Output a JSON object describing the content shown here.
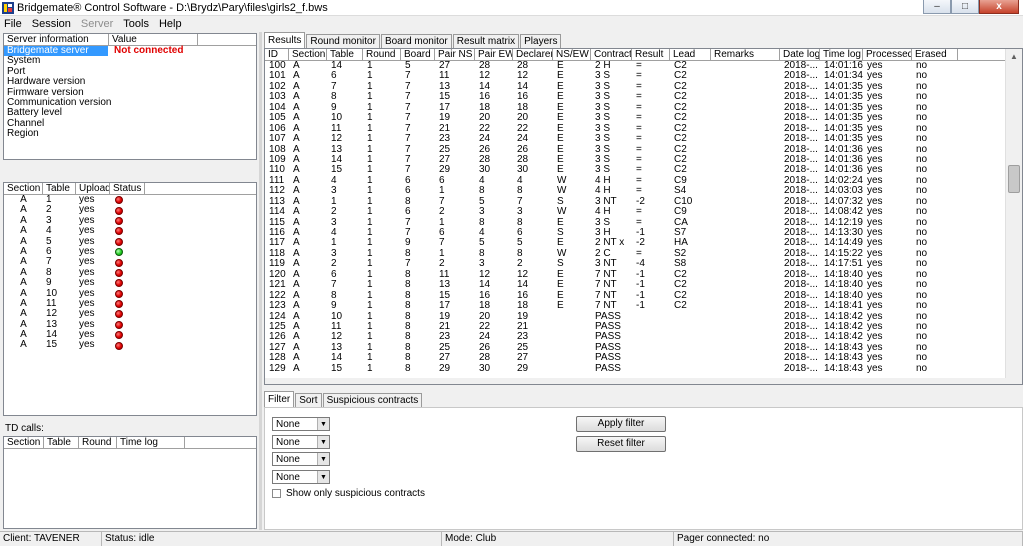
{
  "window": {
    "title": "Bridgemate® Control Software - D:\\Brydz\\Pary\\files\\girls2_f.bws",
    "minimize": "–",
    "maximize": "□",
    "close": "x"
  },
  "menu": [
    "File",
    "Session",
    "Server",
    "Tools",
    "Help"
  ],
  "server_info": {
    "headers": [
      "Server information",
      "Value"
    ],
    "rows": [
      {
        "k": "Bridgemate server",
        "v": "Not connected"
      },
      {
        "k": "System",
        "v": ""
      },
      {
        "k": "Port",
        "v": ""
      },
      {
        "k": "Hardware version",
        "v": ""
      },
      {
        "k": "Firmware version",
        "v": ""
      },
      {
        "k": "Communication version",
        "v": ""
      },
      {
        "k": "Battery level",
        "v": ""
      },
      {
        "k": "Channel",
        "v": ""
      },
      {
        "k": "Region",
        "v": ""
      }
    ]
  },
  "tables_panel": {
    "headers": [
      "Section",
      "Table",
      "Upload",
      "Status"
    ],
    "rows": [
      {
        "s": "A",
        "t": "1",
        "u": "yes",
        "st": "red"
      },
      {
        "s": "A",
        "t": "2",
        "u": "yes",
        "st": "red"
      },
      {
        "s": "A",
        "t": "3",
        "u": "yes",
        "st": "red"
      },
      {
        "s": "A",
        "t": "4",
        "u": "yes",
        "st": "red"
      },
      {
        "s": "A",
        "t": "5",
        "u": "yes",
        "st": "red"
      },
      {
        "s": "A",
        "t": "6",
        "u": "yes",
        "st": "green"
      },
      {
        "s": "A",
        "t": "7",
        "u": "yes",
        "st": "red"
      },
      {
        "s": "A",
        "t": "8",
        "u": "yes",
        "st": "red"
      },
      {
        "s": "A",
        "t": "9",
        "u": "yes",
        "st": "red"
      },
      {
        "s": "A",
        "t": "10",
        "u": "yes",
        "st": "red"
      },
      {
        "s": "A",
        "t": "11",
        "u": "yes",
        "st": "red"
      },
      {
        "s": "A",
        "t": "12",
        "u": "yes",
        "st": "red"
      },
      {
        "s": "A",
        "t": "13",
        "u": "yes",
        "st": "red"
      },
      {
        "s": "A",
        "t": "14",
        "u": "yes",
        "st": "red"
      },
      {
        "s": "A",
        "t": "15",
        "u": "yes",
        "st": "red"
      }
    ]
  },
  "td_calls": {
    "label": "TD calls:",
    "headers": [
      "Section",
      "Table",
      "Round",
      "Time log"
    ]
  },
  "tabs": [
    "Results",
    "Round monitor",
    "Board monitor",
    "Result matrix",
    "Players"
  ],
  "results": {
    "headers": [
      "ID",
      "Section",
      "Table",
      "Round",
      "Board",
      "Pair NS",
      "Pair EW",
      "Declarer",
      "NS/EW",
      "Contract",
      "Result",
      "Lead",
      "Remarks",
      "Date log",
      "Time log",
      "Processed",
      "Erased"
    ],
    "rows": [
      [
        "100",
        "A",
        "14",
        "1",
        "5",
        "27",
        "28",
        "28",
        "E",
        "2 H",
        "=",
        "C2",
        "",
        "2018-...",
        "14:01:16",
        "yes",
        "no"
      ],
      [
        "101",
        "A",
        "6",
        "1",
        "7",
        "11",
        "12",
        "12",
        "E",
        "3 S",
        "=",
        "C2",
        "",
        "2018-...",
        "14:01:34",
        "yes",
        "no"
      ],
      [
        "102",
        "A",
        "7",
        "1",
        "7",
        "13",
        "14",
        "14",
        "E",
        "3 S",
        "=",
        "C2",
        "",
        "2018-...",
        "14:01:35",
        "yes",
        "no"
      ],
      [
        "103",
        "A",
        "8",
        "1",
        "7",
        "15",
        "16",
        "16",
        "E",
        "3 S",
        "=",
        "C2",
        "",
        "2018-...",
        "14:01:35",
        "yes",
        "no"
      ],
      [
        "104",
        "A",
        "9",
        "1",
        "7",
        "17",
        "18",
        "18",
        "E",
        "3 S",
        "=",
        "C2",
        "",
        "2018-...",
        "14:01:35",
        "yes",
        "no"
      ],
      [
        "105",
        "A",
        "10",
        "1",
        "7",
        "19",
        "20",
        "20",
        "E",
        "3 S",
        "=",
        "C2",
        "",
        "2018-...",
        "14:01:35",
        "yes",
        "no"
      ],
      [
        "106",
        "A",
        "11",
        "1",
        "7",
        "21",
        "22",
        "22",
        "E",
        "3 S",
        "=",
        "C2",
        "",
        "2018-...",
        "14:01:35",
        "yes",
        "no"
      ],
      [
        "107",
        "A",
        "12",
        "1",
        "7",
        "23",
        "24",
        "24",
        "E",
        "3 S",
        "=",
        "C2",
        "",
        "2018-...",
        "14:01:35",
        "yes",
        "no"
      ],
      [
        "108",
        "A",
        "13",
        "1",
        "7",
        "25",
        "26",
        "26",
        "E",
        "3 S",
        "=",
        "C2",
        "",
        "2018-...",
        "14:01:36",
        "yes",
        "no"
      ],
      [
        "109",
        "A",
        "14",
        "1",
        "7",
        "27",
        "28",
        "28",
        "E",
        "3 S",
        "=",
        "C2",
        "",
        "2018-...",
        "14:01:36",
        "yes",
        "no"
      ],
      [
        "110",
        "A",
        "15",
        "1",
        "7",
        "29",
        "30",
        "30",
        "E",
        "3 S",
        "=",
        "C2",
        "",
        "2018-...",
        "14:01:36",
        "yes",
        "no"
      ],
      [
        "111",
        "A",
        "4",
        "1",
        "6",
        "6",
        "4",
        "4",
        "W",
        "4 H",
        "=",
        "C9",
        "",
        "2018-...",
        "14:02:24",
        "yes",
        "no"
      ],
      [
        "112",
        "A",
        "3",
        "1",
        "6",
        "1",
        "8",
        "8",
        "W",
        "4 H",
        "=",
        "S4",
        "",
        "2018-...",
        "14:03:03",
        "yes",
        "no"
      ],
      [
        "113",
        "A",
        "1",
        "1",
        "8",
        "7",
        "5",
        "7",
        "S",
        "3 NT",
        "-2",
        "C10",
        "",
        "2018-...",
        "14:07:32",
        "yes",
        "no"
      ],
      [
        "114",
        "A",
        "2",
        "1",
        "6",
        "2",
        "3",
        "3",
        "W",
        "4 H",
        "=",
        "C9",
        "",
        "2018-...",
        "14:08:42",
        "yes",
        "no"
      ],
      [
        "115",
        "A",
        "3",
        "1",
        "7",
        "1",
        "8",
        "8",
        "E",
        "3 S",
        "=",
        "CA",
        "",
        "2018-...",
        "14:12:19",
        "yes",
        "no"
      ],
      [
        "116",
        "A",
        "4",
        "1",
        "7",
        "6",
        "4",
        "6",
        "S",
        "3 H",
        "-1",
        "S7",
        "",
        "2018-...",
        "14:13:30",
        "yes",
        "no"
      ],
      [
        "117",
        "A",
        "1",
        "1",
        "9",
        "7",
        "5",
        "5",
        "E",
        "2 NT x",
        "-2",
        "HA",
        "",
        "2018-...",
        "14:14:49",
        "yes",
        "no"
      ],
      [
        "118",
        "A",
        "3",
        "1",
        "8",
        "1",
        "8",
        "8",
        "W",
        "2 C",
        "=",
        "S2",
        "",
        "2018-...",
        "14:15:22",
        "yes",
        "no"
      ],
      [
        "119",
        "A",
        "2",
        "1",
        "7",
        "2",
        "3",
        "2",
        "S",
        "3 NT",
        "-4",
        "S8",
        "",
        "2018-...",
        "14:17:51",
        "yes",
        "no"
      ],
      [
        "120",
        "A",
        "6",
        "1",
        "8",
        "11",
        "12",
        "12",
        "E",
        "7 NT",
        "-1",
        "C2",
        "",
        "2018-...",
        "14:18:40",
        "yes",
        "no"
      ],
      [
        "121",
        "A",
        "7",
        "1",
        "8",
        "13",
        "14",
        "14",
        "E",
        "7 NT",
        "-1",
        "C2",
        "",
        "2018-...",
        "14:18:40",
        "yes",
        "no"
      ],
      [
        "122",
        "A",
        "8",
        "1",
        "8",
        "15",
        "16",
        "16",
        "E",
        "7 NT",
        "-1",
        "C2",
        "",
        "2018-...",
        "14:18:40",
        "yes",
        "no"
      ],
      [
        "123",
        "A",
        "9",
        "1",
        "8",
        "17",
        "18",
        "18",
        "E",
        "7 NT",
        "-1",
        "C2",
        "",
        "2018-...",
        "14:18:41",
        "yes",
        "no"
      ],
      [
        "124",
        "A",
        "10",
        "1",
        "8",
        "19",
        "20",
        "19",
        "",
        "PASS",
        "",
        "",
        "",
        "2018-...",
        "14:18:42",
        "yes",
        "no"
      ],
      [
        "125",
        "A",
        "11",
        "1",
        "8",
        "21",
        "22",
        "21",
        "",
        "PASS",
        "",
        "",
        "",
        "2018-...",
        "14:18:42",
        "yes",
        "no"
      ],
      [
        "126",
        "A",
        "12",
        "1",
        "8",
        "23",
        "24",
        "23",
        "",
        "PASS",
        "",
        "",
        "",
        "2018-...",
        "14:18:42",
        "yes",
        "no"
      ],
      [
        "127",
        "A",
        "13",
        "1",
        "8",
        "25",
        "26",
        "25",
        "",
        "PASS",
        "",
        "",
        "",
        "2018-...",
        "14:18:43",
        "yes",
        "no"
      ],
      [
        "128",
        "A",
        "14",
        "1",
        "8",
        "27",
        "28",
        "27",
        "",
        "PASS",
        "",
        "",
        "",
        "2018-...",
        "14:18:43",
        "yes",
        "no"
      ],
      [
        "129",
        "A",
        "15",
        "1",
        "8",
        "29",
        "30",
        "29",
        "",
        "PASS",
        "",
        "",
        "",
        "2018-...",
        "14:18:43",
        "yes",
        "no"
      ]
    ]
  },
  "bottom_tabs": [
    "Filter",
    "Sort",
    "Suspicious contracts"
  ],
  "filter": {
    "selects": [
      "None",
      "None",
      "None",
      "None"
    ],
    "apply": "Apply filter",
    "reset": "Reset filter",
    "checkbox_label": "Show only suspicious contracts"
  },
  "status": {
    "client": "Client: TAVENER",
    "status": "Status: idle",
    "mode": "Mode: Club",
    "pager": "Pager connected: no"
  }
}
